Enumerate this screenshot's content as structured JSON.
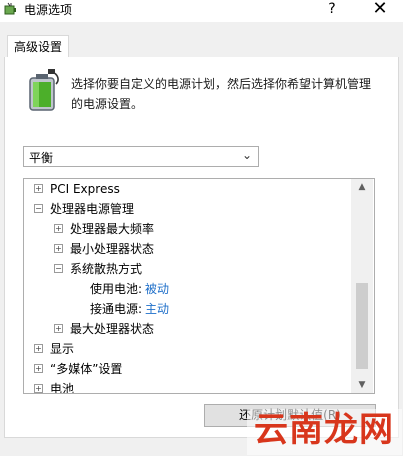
{
  "window": {
    "title": "电源选项",
    "help_glyph": "?",
    "close_glyph": "✕"
  },
  "tabs": [
    {
      "label": "高级设置"
    }
  ],
  "description": "选择你要自定义的电源计划，然后选择你希望计算机管理的电源设置。",
  "plan_select": {
    "value": "平衡",
    "arrow": "⌄"
  },
  "tree": {
    "rows": [
      {
        "expander": "+",
        "label": "PCI Express"
      },
      {
        "expander": "−",
        "label": "处理器电源管理"
      },
      {
        "expander": "+",
        "label": "处理器最大频率"
      },
      {
        "expander": "+",
        "label": "最小处理器状态"
      },
      {
        "expander": "−",
        "label": "系统散热方式"
      },
      {
        "label": "使用电池:",
        "value": "被动"
      },
      {
        "label": "接通电源:",
        "value": "主动"
      },
      {
        "expander": "+",
        "label": "最大处理器状态"
      },
      {
        "expander": "+",
        "label": "显示"
      },
      {
        "expander": "+",
        "label": "“多媒体”设置"
      },
      {
        "expander": "+",
        "label": "电池"
      }
    ]
  },
  "scrollbar": {
    "up_glyph": "▲",
    "down_glyph": "▼"
  },
  "buttons": {
    "restore": "还原计划默认值(R)"
  },
  "watermark": {
    "text": "云南龙网"
  },
  "colors": {
    "link": "#1e6fc9",
    "watermark": "#d8361c"
  },
  "icons": {
    "app": "power-options-icon",
    "battery": "battery-plug-icon"
  }
}
